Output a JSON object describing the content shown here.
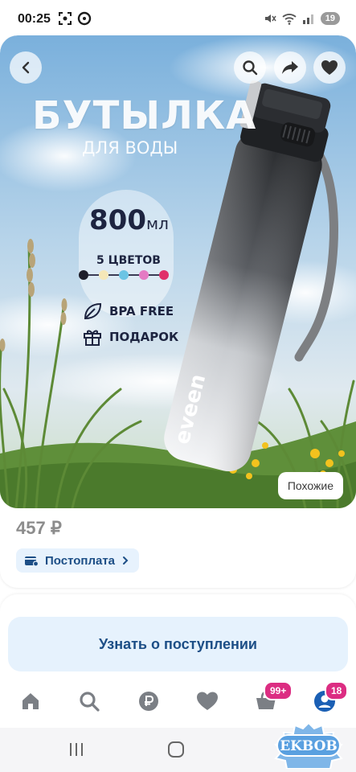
{
  "status_bar": {
    "time": "00:25",
    "icons_left": [
      "screenshot-icon",
      "shazam-icon"
    ],
    "icons_right": [
      "mute-icon",
      "wifi-icon",
      "signal-icon"
    ],
    "battery": "19"
  },
  "hero": {
    "title": "БУТЫЛКА",
    "subtitle": "ДЛЯ ВОДЫ",
    "volume_value": "800",
    "volume_unit": "мл",
    "colors_label": "5 ЦВЕТОВ",
    "color_swatches": [
      "#1e1e2a",
      "#f5e7b8",
      "#6cc4e4",
      "#e47ac3",
      "#e0306a"
    ],
    "features": [
      {
        "icon": "leaf-icon",
        "label": "BPA FREE"
      },
      {
        "icon": "gift-icon",
        "label": "ПОДАРОК"
      }
    ],
    "bottle_brand": "eveen",
    "back_icon": "back-icon",
    "search_icon": "search-icon",
    "share_icon": "share-icon",
    "favorite_icon": "heart-icon",
    "similar_label": "Похожие"
  },
  "product": {
    "price": "457 ₽",
    "postpay_label": "Постоплата"
  },
  "notify_button": "Узнать о поступлении",
  "bottom_nav": {
    "items": [
      {
        "icon": "home-icon"
      },
      {
        "icon": "search-icon"
      },
      {
        "icon": "ruble-icon"
      },
      {
        "icon": "heart-icon"
      },
      {
        "icon": "cart-icon",
        "badge": "99+"
      },
      {
        "icon": "profile-icon",
        "badge": "18"
      }
    ],
    "active_color": "#1a5fb4"
  },
  "watermark": "EKBOB",
  "colors": {
    "accent": "#1c4e86",
    "badge": "#dc2d82",
    "button_bg": "#e6f2fd"
  }
}
